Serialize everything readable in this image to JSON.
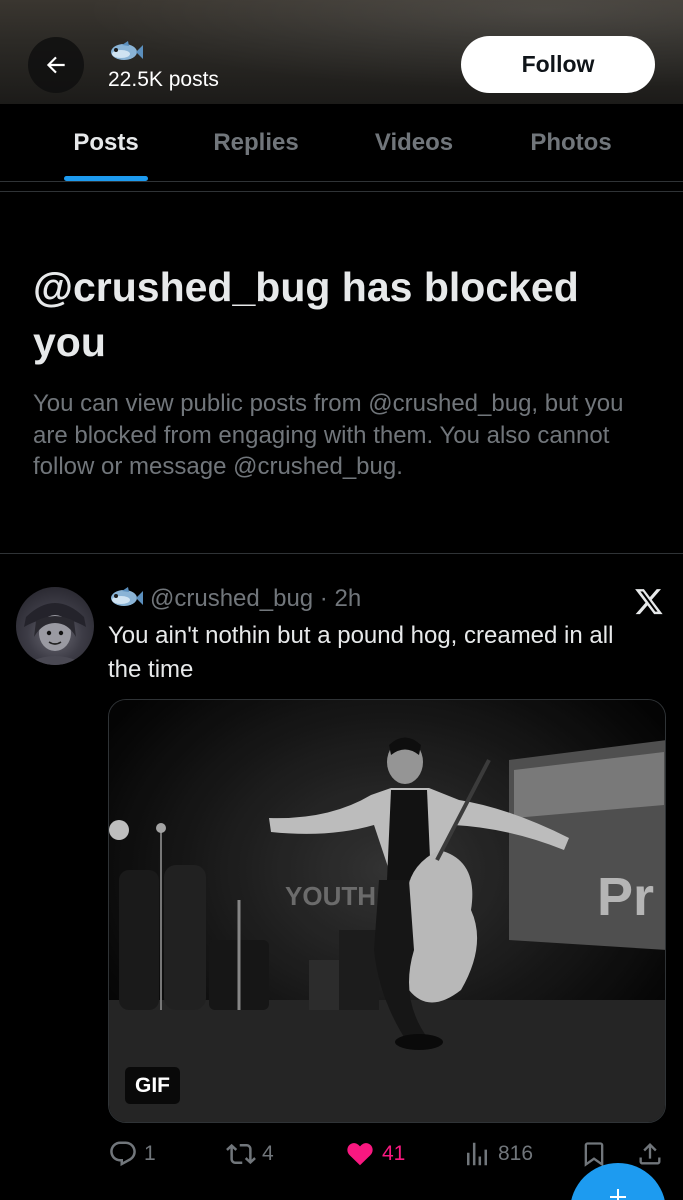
{
  "header": {
    "emoji": "🐟",
    "posts_count": "22.5K posts",
    "follow_label": "Follow"
  },
  "tabs": [
    {
      "label": "Posts",
      "active": true
    },
    {
      "label": "Replies",
      "active": false
    },
    {
      "label": "Videos",
      "active": false
    },
    {
      "label": "Photos",
      "active": false
    }
  ],
  "blocked": {
    "title": "@crushed_bug has blocked you",
    "description": "You can view public posts from @crushed_bug, but you are blocked from engaging with them. You also cannot follow or message @crushed_bug."
  },
  "post": {
    "emoji": "🐟",
    "handle_line": "@crushed_bug · 2h",
    "text": "You ain't nothin but a pound hog,  creamed in all the time",
    "media_badge": "GIF",
    "media_sign_text": "YOUTH",
    "media_sign_text_2": "Pr",
    "actions": {
      "replies": "1",
      "reposts": "4",
      "likes": "41",
      "views": "816"
    }
  },
  "colors": {
    "accent": "#1d9bf0",
    "like": "#f91880",
    "muted": "#71767b",
    "text": "#e7e9ea",
    "border": "#2f3336"
  },
  "icons": {
    "back": "arrow-left-icon",
    "x_logo": "x-logo-icon",
    "reply": "reply-icon",
    "repost": "repost-icon",
    "like": "heart-icon",
    "views": "views-icon",
    "bookmark": "bookmark-icon",
    "share": "share-icon",
    "compose": "compose-icon"
  }
}
